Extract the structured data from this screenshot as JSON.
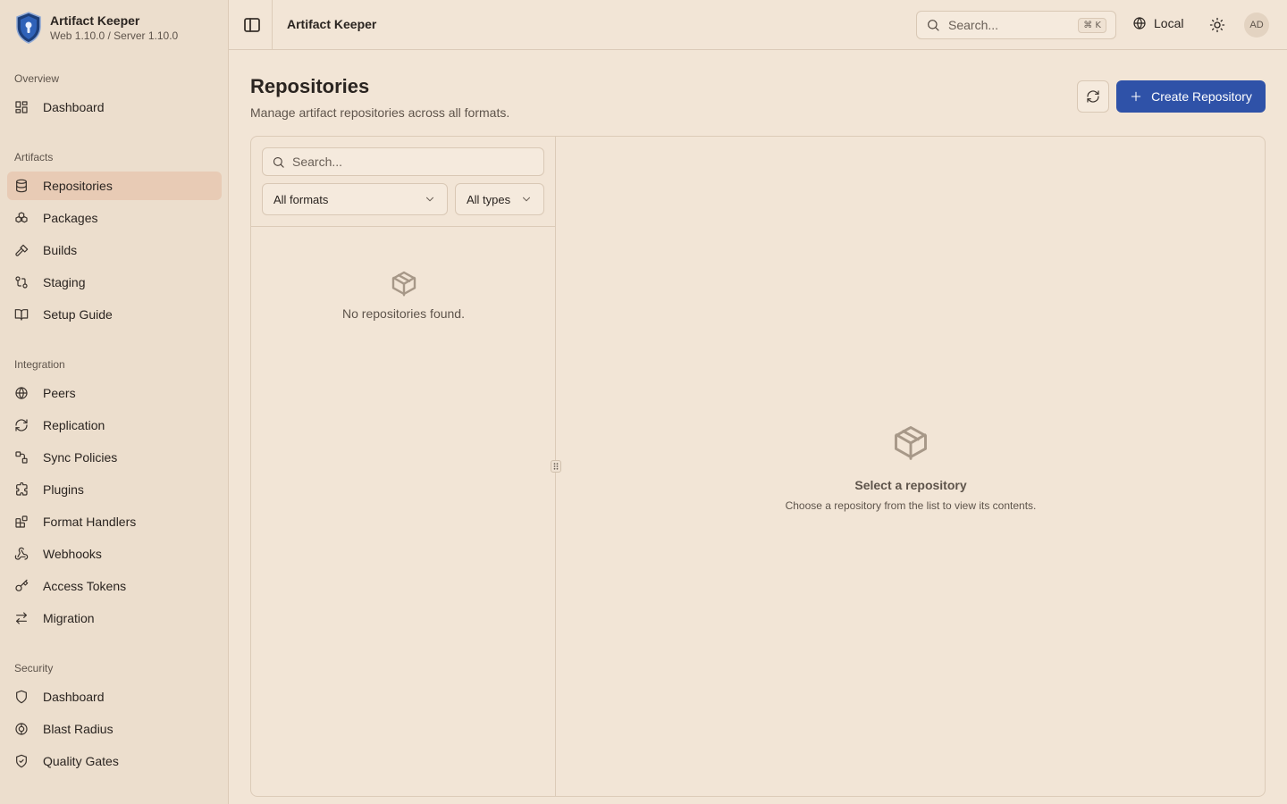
{
  "brand": {
    "title": "Artifact Keeper",
    "version": "Web 1.10.0 / Server 1.10.0"
  },
  "sidebar": {
    "sections": [
      {
        "heading": "Overview",
        "items": [
          {
            "label": "Dashboard",
            "icon": "dashboard-icon"
          }
        ]
      },
      {
        "heading": "Artifacts",
        "items": [
          {
            "label": "Repositories",
            "icon": "database-icon",
            "active": true
          },
          {
            "label": "Packages",
            "icon": "packages-icon"
          },
          {
            "label": "Builds",
            "icon": "hammer-icon"
          },
          {
            "label": "Staging",
            "icon": "git-compare-icon"
          },
          {
            "label": "Setup Guide",
            "icon": "book-icon"
          }
        ]
      },
      {
        "heading": "Integration",
        "items": [
          {
            "label": "Peers",
            "icon": "globe-icon"
          },
          {
            "label": "Replication",
            "icon": "refresh-icon"
          },
          {
            "label": "Sync Policies",
            "icon": "route-icon"
          },
          {
            "label": "Plugins",
            "icon": "puzzle-icon"
          },
          {
            "label": "Format Handlers",
            "icon": "blocks-icon"
          },
          {
            "label": "Webhooks",
            "icon": "webhook-icon"
          },
          {
            "label": "Access Tokens",
            "icon": "key-icon"
          },
          {
            "label": "Migration",
            "icon": "arrows-swap-icon"
          }
        ]
      },
      {
        "heading": "Security",
        "items": [
          {
            "label": "Dashboard",
            "icon": "shield-icon"
          },
          {
            "label": "Blast Radius",
            "icon": "radius-icon"
          },
          {
            "label": "Quality Gates",
            "icon": "shield-check-icon"
          }
        ]
      }
    ]
  },
  "header": {
    "title": "Artifact Keeper",
    "search_placeholder": "Search...",
    "shortcut": "⌘ K",
    "environment": "Local",
    "avatar_initials": "AD"
  },
  "page": {
    "title": "Repositories",
    "subtitle": "Manage artifact repositories across all formats.",
    "create_label": "Create Repository"
  },
  "list": {
    "search_placeholder": "Search...",
    "format_filter": "All formats",
    "type_filter": "All types",
    "empty_text": "No repositories found."
  },
  "detail": {
    "empty_title": "Select a repository",
    "empty_text": "Choose a repository from the list to view its contents."
  },
  "colors": {
    "accent": "#2f52a8",
    "active_nav": "#e8cbb5",
    "background": "#f2e5d6"
  }
}
